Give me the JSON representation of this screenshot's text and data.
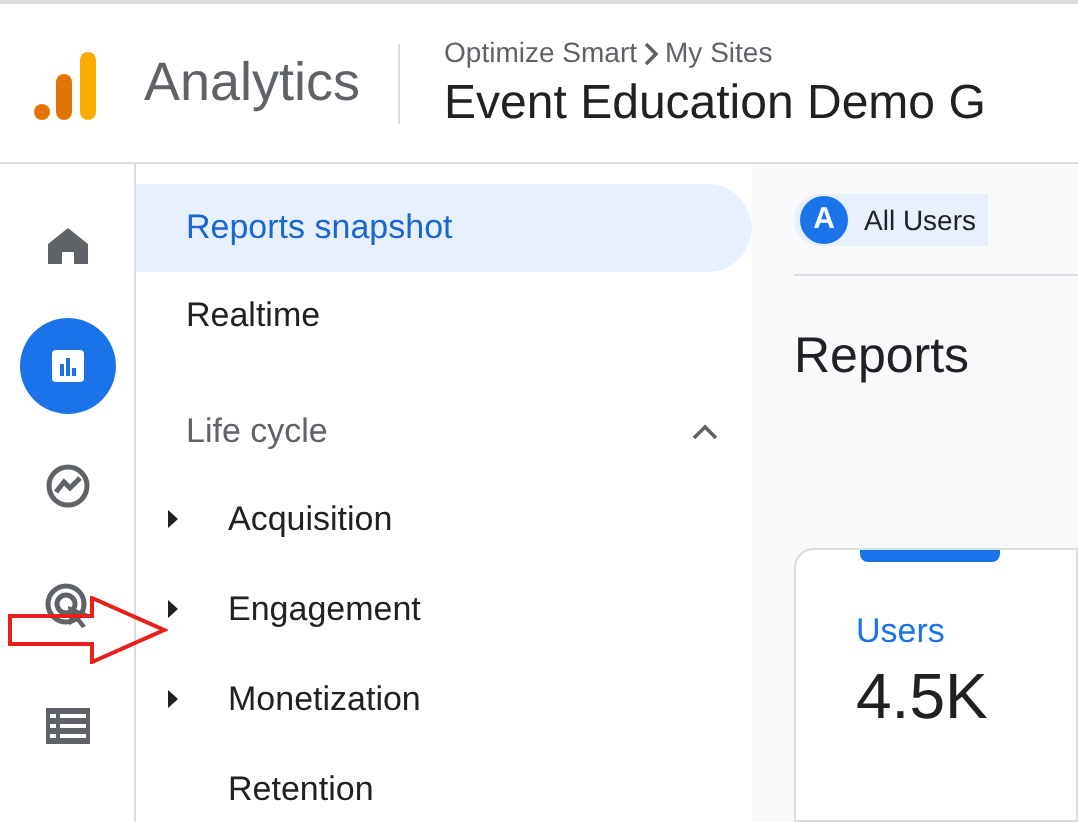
{
  "header": {
    "product": "Analytics",
    "breadcrumb": [
      "Optimize Smart",
      "My Sites"
    ],
    "property_title": "Event Education Demo G"
  },
  "rail": [
    {
      "selected": false
    },
    {
      "selected": true
    },
    {
      "selected": false
    },
    {
      "selected": false
    },
    {
      "selected": false
    }
  ],
  "nav": {
    "top_items": [
      {
        "label": "Reports snapshot",
        "selected": true
      },
      {
        "label": "Realtime",
        "selected": false
      }
    ],
    "section": {
      "title": "Life cycle",
      "expanded": true,
      "items": [
        {
          "label": "Acquisition",
          "expandable": true
        },
        {
          "label": "Engagement",
          "expandable": true
        },
        {
          "label": "Monetization",
          "expandable": true
        },
        {
          "label": "Retention",
          "expandable": false
        }
      ]
    }
  },
  "main": {
    "comparison_chip": {
      "badge": "A",
      "label": "All Users"
    },
    "page_title": "Reports",
    "card": {
      "metric": "Users",
      "value": "4.5K"
    }
  }
}
